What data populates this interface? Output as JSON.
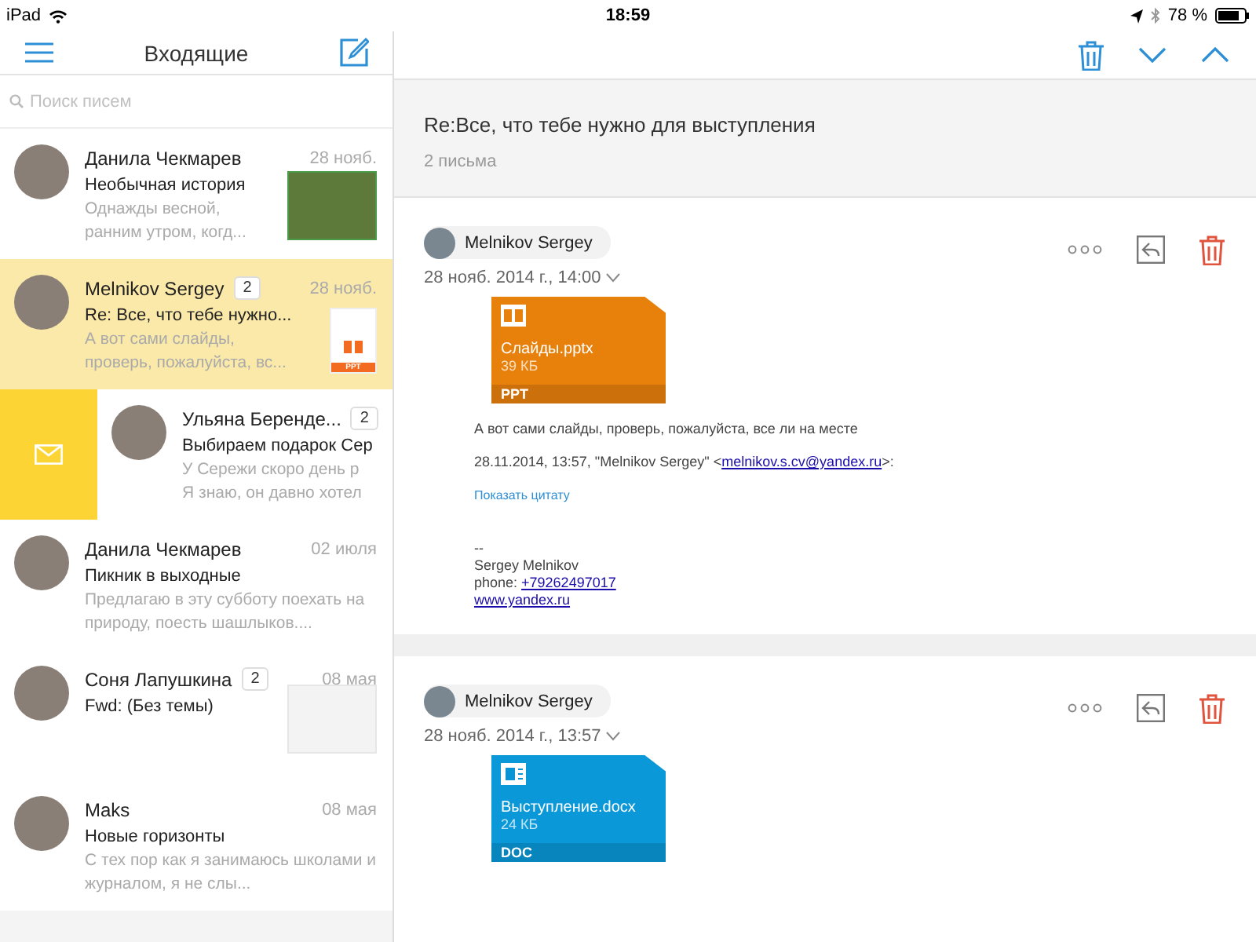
{
  "status_bar": {
    "device": "iPad",
    "time": "18:59",
    "battery": "78 %"
  },
  "inbox": {
    "title": "Входящие",
    "search": {
      "placeholder": "Поиск писем"
    },
    "messages": [
      {
        "kind": "normal",
        "selected": false,
        "sender": "Данила Чекмарев",
        "date": "28 нояб.",
        "subject": "Необычная история",
        "preview": "Однажды весной, ранним утром, когд...",
        "thumbnail": {
          "kind": "photo"
        }
      },
      {
        "kind": "normal",
        "selected": true,
        "sender": "Melnikov Sergey",
        "count": "2",
        "date": "28 нояб.",
        "subject": "Re: Все, что тебе нужно...",
        "preview": "А вот сами слайды, проверь, пожалуйста, вс...",
        "thumbnail": {
          "kind": "ppt",
          "label": "PPT"
        }
      },
      {
        "kind": "swiped",
        "selected": false,
        "sender": "Ульяна Беренде...",
        "count": "2",
        "subject": "Выбираем подарок Сер",
        "preview": "У Сережи скоро день р\nЯ знаю, он давно хотел"
      },
      {
        "kind": "normal",
        "selected": false,
        "sender": "Данила Чекмарев",
        "date": "02 июля",
        "subject": "Пикник в выходные",
        "preview": "Предлагаю в эту субботу поехать на природу, поесть шашлыков...."
      },
      {
        "kind": "normal",
        "selected": false,
        "sender": "Соня Лапушкина",
        "count": "2",
        "date": "08 мая",
        "subject": "Fwd: (Без темы)",
        "thumbnail": {
          "kind": "document"
        }
      },
      {
        "kind": "normal",
        "selected": false,
        "sender": "Maks",
        "date": "08 мая",
        "subject": "Новые горизонты",
        "preview": "С тех пор как я занимаюсь школами и журналом, я не слы..."
      }
    ]
  },
  "thread": {
    "subject": "Re:Все, что тебе нужно для выступления",
    "count": "2 письма",
    "letters": [
      {
        "sender": "Melnikov Sergey",
        "date": "28 нояб. 2014 г., 14:00",
        "attachment": {
          "kind": "ppt",
          "name": "Слайды.pptx",
          "size": "39 КБ",
          "label": "PPT"
        },
        "body": "А вот сами слайды, проверь, пожалуйста, все ли на месте",
        "quote_header": {
          "before": "28.11.2014, 13:57, \"Melnikov Sergey\" <",
          "link": "melnikov.s.cv@yandex.ru",
          "after": ">:"
        },
        "show_quote": "Показать цитату",
        "signature": {
          "dash": "--",
          "name": "Sergey Melnikov",
          "phone_label": "phone: ",
          "phone": "+79262497017",
          "site": "www.yandex.ru"
        }
      },
      {
        "sender": "Melnikov Sergey",
        "date": "28 нояб. 2014 г., 13:57",
        "attachment": {
          "kind": "doc",
          "name": "Выступление.docx",
          "size": "24 КБ",
          "label": "DOC"
        }
      }
    ]
  }
}
